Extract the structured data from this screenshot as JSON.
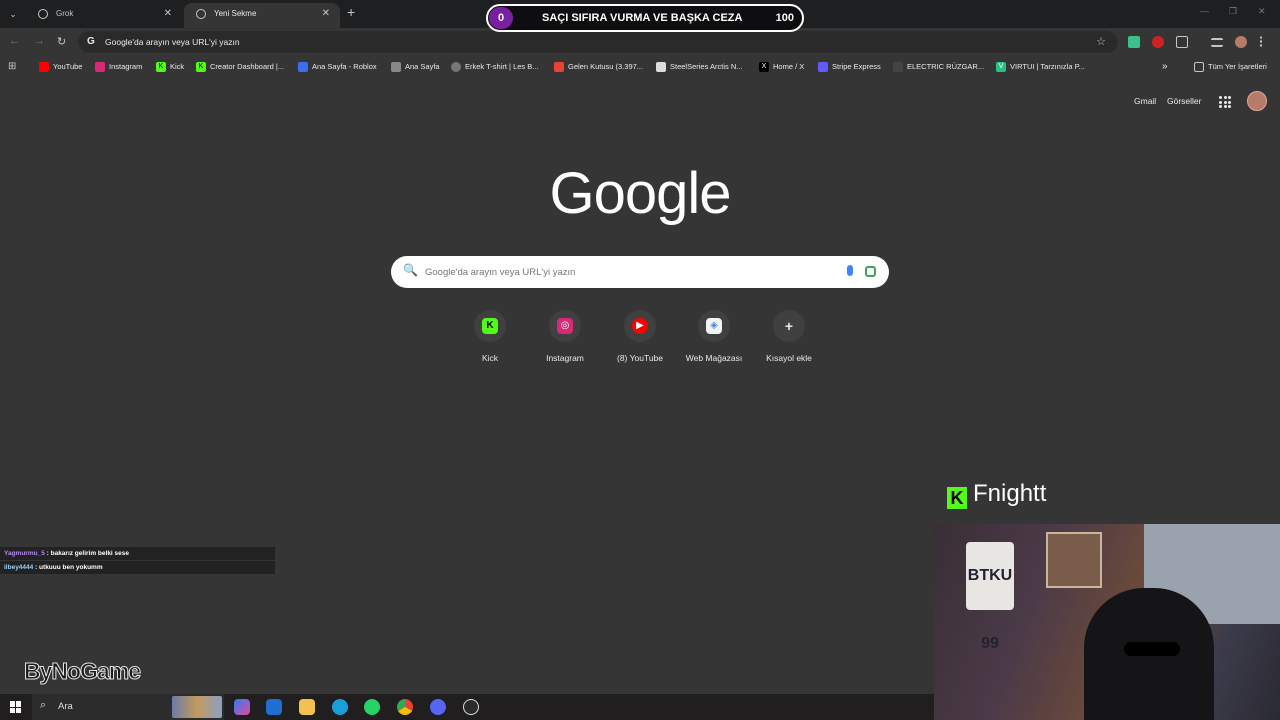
{
  "tabs": [
    {
      "label": "Grok",
      "close": "✕"
    },
    {
      "label": "Yeni Sekme",
      "close": "✕"
    }
  ],
  "tab_menu_icon": "⌄",
  "new_tab": "+",
  "banner": {
    "left_number": "0",
    "text": "SAÇI SIFIRA VURMA VE BAŞKA CEZA",
    "right_number": "100"
  },
  "window_controls": {
    "minimize": "—",
    "maximize": "❐",
    "close": "✕"
  },
  "nav": {
    "back": "←",
    "forward": "→",
    "reload": "↻"
  },
  "omnibox": {
    "g": "G",
    "text": "Google'da arayın veya URL'yi yazın",
    "star": "☆"
  },
  "bookmarks": [
    {
      "label": "YouTube",
      "color": "#ff0000"
    },
    {
      "label": "Instagram",
      "color": "#d62976"
    },
    {
      "label": "Kick",
      "color": "#53fc18"
    },
    {
      "label": "Creator Dashboard |...",
      "color": "#53fc18"
    },
    {
      "label": "Ana Sayfa - Roblox",
      "color": "#3a6df0"
    },
    {
      "label": "Ana Sayfa",
      "color": "#888888"
    },
    {
      "label": "Erkek T-shirt | Les B...",
      "color": "#777777"
    },
    {
      "label": "Gelen Kutusu (3.397...",
      "color": "#ea4335"
    },
    {
      "label": "SteelSeries Arctis N...",
      "color": "#dddddd"
    },
    {
      "label": "Home / X",
      "color": "#000000"
    },
    {
      "label": "Stripe Express",
      "color": "#635bff"
    },
    {
      "label": "ELECTRIC RÜZGAR...",
      "color": "#444444"
    },
    {
      "label": "VIRTUI | Tarzınızla P...",
      "color": "#26c281"
    }
  ],
  "bookmarks_more": "»",
  "all_bookmarks": "Tüm Yer İşaretleri",
  "header_links": {
    "gmail": "Gmail",
    "images": "Görseller"
  },
  "logo": "Google",
  "search": {
    "placeholder": "Google'da arayın veya URL'yi yazın",
    "icon": "🔍"
  },
  "shortcuts": [
    {
      "label": "Kick",
      "glyph": "K",
      "color": "#53fc18"
    },
    {
      "label": "Instagram",
      "glyph": "◎",
      "color": "#d62976"
    },
    {
      "label": "(8) YouTube",
      "glyph": "▶",
      "color": "#ff0000"
    },
    {
      "label": "Web Mağazası",
      "glyph": "◈",
      "color": "#4285f4"
    },
    {
      "label": "Kısayol ekle",
      "glyph": "+",
      "color": "#404040"
    }
  ],
  "overlay": {
    "kick_name": "Fnightt",
    "chat": [
      {
        "user": "Yagmurmu_5",
        "msg": " : bakarız gelirim belki sese"
      },
      {
        "user": "ilbey4444",
        "msg": " : utkuuu ben yokumm"
      }
    ],
    "sponsor": "ByNoGame",
    "webcam_shirt": "BTKU 99"
  },
  "taskbar": {
    "search": "Ara"
  }
}
